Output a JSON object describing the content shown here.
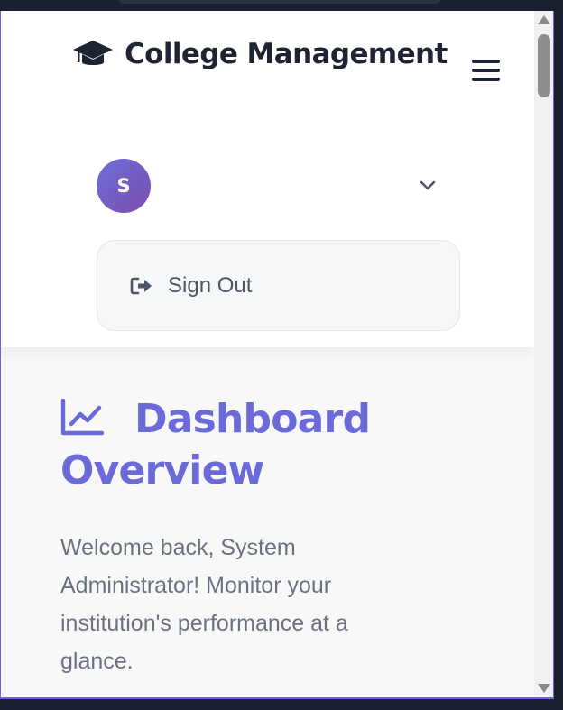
{
  "header": {
    "brand_title": "College Management",
    "brand_icon": "graduation-cap-icon",
    "menu_icon": "hamburger-menu-icon"
  },
  "user_menu": {
    "avatar_initial": "S",
    "dropdown_icon": "chevron-down-icon",
    "sign_out_label": "Sign Out",
    "sign_out_icon": "sign-out-icon"
  },
  "dashboard": {
    "icon": "line-chart-icon",
    "title": "Dashboard Overview",
    "welcome_text": "Welcome back, System Administrator! Monitor your institution's performance at a glance."
  },
  "colors": {
    "accent": "#6a6ad8",
    "avatar_gradient_start": "#6c6fd8",
    "avatar_gradient_end": "#7b4dae",
    "heading": "#1f2433",
    "muted_text": "#6a7282"
  }
}
